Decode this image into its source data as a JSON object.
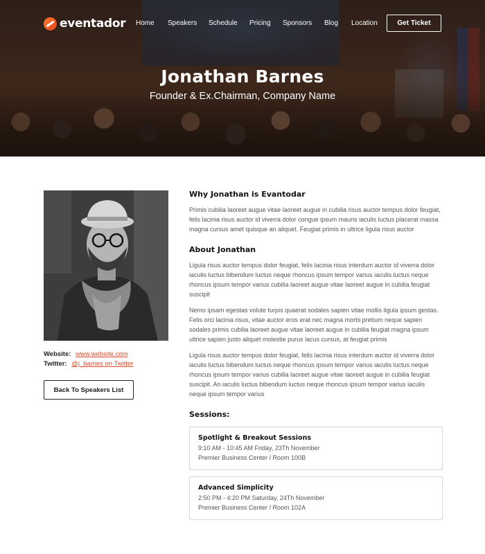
{
  "brand": {
    "name": "eventador"
  },
  "nav": {
    "items": [
      "Home",
      "Speakers",
      "Schedule",
      "Pricing",
      "Sponsors",
      "Blog",
      "Location"
    ],
    "cta": "Get Ticket"
  },
  "hero": {
    "name": "Jonathan Barnes",
    "title": "Founder & Ex.Chairman, Company Name"
  },
  "contact": {
    "website_label": "Website:",
    "website_value": "www.website.com",
    "twitter_label": "Twitter:",
    "twitter_value": "@j_bames on Twitter"
  },
  "back_button": "Back To Speakers List",
  "why": {
    "heading": "Why Jonathan is Evantodar",
    "text": "Primis cubilia laoreet augue vitae laoreet augue in cubilia risus auctor tempus dolor feugiat, felis lacinia risus auctor id viverra dolor congue ipsum mauris iaculis luctus placerat massa magna cursus amet quisque an aliquet. Feugiat primis in ultrice ligula risus auctor"
  },
  "about": {
    "heading": "About Jonathan",
    "p1": "Ligula risus auctor tempus dolor feugiat, felis lacinia risus interdum auctor id viverra dolor iaculis luctus bibendum luctus neque rhoncus ipsum tempor varius iaculis luctus neque rhoncus ipsum tempor varius cubilia laoreet augue vitae laoreet augue in cubilia feugiat suscipit",
    "p2": "Nemo ipsam egestas volute turpis quaerat sodales sapien vitae mollis ligula ipsum gestas. Felis orci lacinia risus, vitae auctor eros erat nec magna morbi pretium neque sapien sodales primis cubilia laoreet augue vitae laoreet augue in cubilia feugiat magna ipsum ultrice sapien justo aliquet molestie purus lacus cursus, at feugiat primis",
    "p3": "Ligula risus auctor tempus dolor feugiat, felis lacinia risus interdum auctor id viverra dolor iaculis luctus bibendum luctus neque rhoncus ipsum tempor varius iaculis luctus neque rhoncus ipsum tempor varius cubilia laoreet augue vitae laoreet augue in cubilia feugiat suscipit. An iaculis luctus bibendum luctus neque rhoncus ipsum tempor varius iaculis neque ipsum tempor varius"
  },
  "sessions": {
    "heading": "Sessions:",
    "items": [
      {
        "title": "Spotlight & Breakout Sessions",
        "time": "9:10 AM - 10:45 AM Friday, 23Th November",
        "place": "Premier Business Center / Room 100B"
      },
      {
        "title": "Advanced Simplicity",
        "time": "2:50 PM - 4:20 PM Saturday, 24Th November",
        "place": "Premier Business Center / Room 102A"
      }
    ]
  },
  "colors": {
    "accent": "#e2492b",
    "logo_orange": "#ff6a1f"
  }
}
